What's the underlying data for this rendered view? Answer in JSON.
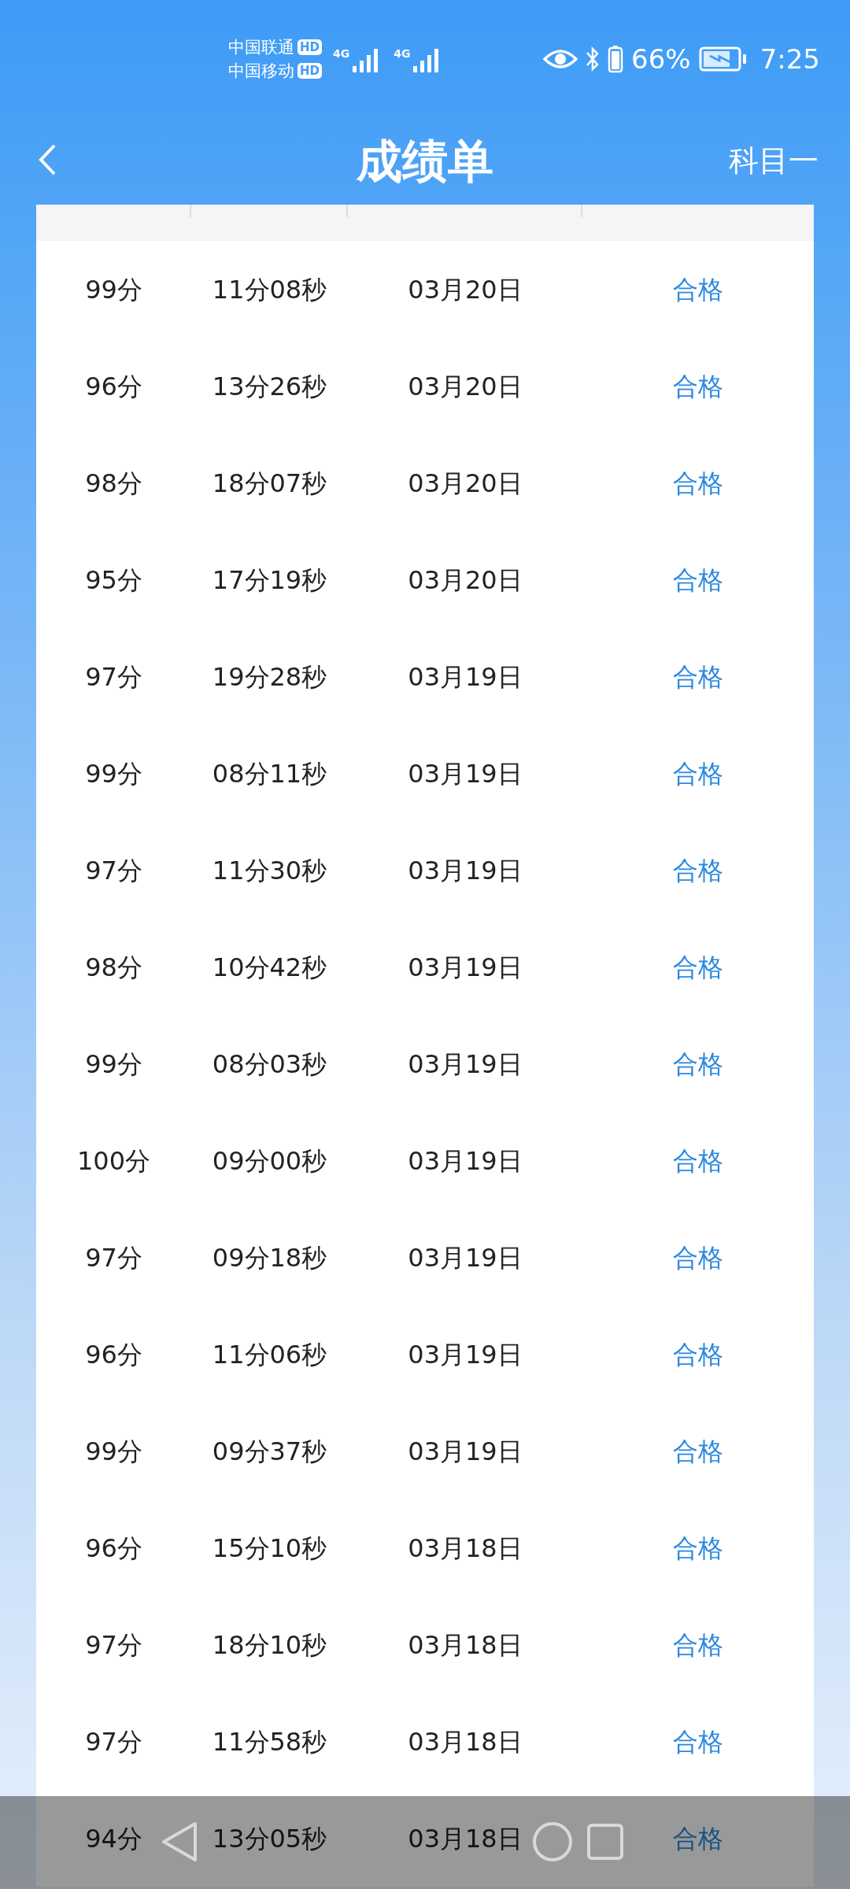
{
  "status_bar": {
    "carriers": [
      {
        "name": "中国联通",
        "badge": "HD",
        "network": "4G"
      },
      {
        "name": "中国移动",
        "badge": "HD",
        "network": "4G"
      }
    ],
    "battery_percent": "66%",
    "time": "7:25"
  },
  "header": {
    "title": "成绩单",
    "subject": "科目一"
  },
  "table": {
    "rows": [
      {
        "score": "99分",
        "duration": "11分08秒",
        "date": "03月20日",
        "result": "合格"
      },
      {
        "score": "96分",
        "duration": "13分26秒",
        "date": "03月20日",
        "result": "合格"
      },
      {
        "score": "98分",
        "duration": "18分07秒",
        "date": "03月20日",
        "result": "合格"
      },
      {
        "score": "95分",
        "duration": "17分19秒",
        "date": "03月20日",
        "result": "合格"
      },
      {
        "score": "97分",
        "duration": "19分28秒",
        "date": "03月19日",
        "result": "合格"
      },
      {
        "score": "99分",
        "duration": "08分11秒",
        "date": "03月19日",
        "result": "合格"
      },
      {
        "score": "97分",
        "duration": "11分30秒",
        "date": "03月19日",
        "result": "合格"
      },
      {
        "score": "98分",
        "duration": "10分42秒",
        "date": "03月19日",
        "result": "合格"
      },
      {
        "score": "99分",
        "duration": "08分03秒",
        "date": "03月19日",
        "result": "合格"
      },
      {
        "score": "100分",
        "duration": "09分00秒",
        "date": "03月19日",
        "result": "合格"
      },
      {
        "score": "97分",
        "duration": "09分18秒",
        "date": "03月19日",
        "result": "合格"
      },
      {
        "score": "96分",
        "duration": "11分06秒",
        "date": "03月19日",
        "result": "合格"
      },
      {
        "score": "99分",
        "duration": "09分37秒",
        "date": "03月19日",
        "result": "合格"
      },
      {
        "score": "96分",
        "duration": "15分10秒",
        "date": "03月18日",
        "result": "合格"
      },
      {
        "score": "97分",
        "duration": "18分10秒",
        "date": "03月18日",
        "result": "合格"
      },
      {
        "score": "97分",
        "duration": "11分58秒",
        "date": "03月18日",
        "result": "合格"
      },
      {
        "score": "94分",
        "duration": "13分05秒",
        "date": "03月18日",
        "result": "合格"
      }
    ]
  }
}
